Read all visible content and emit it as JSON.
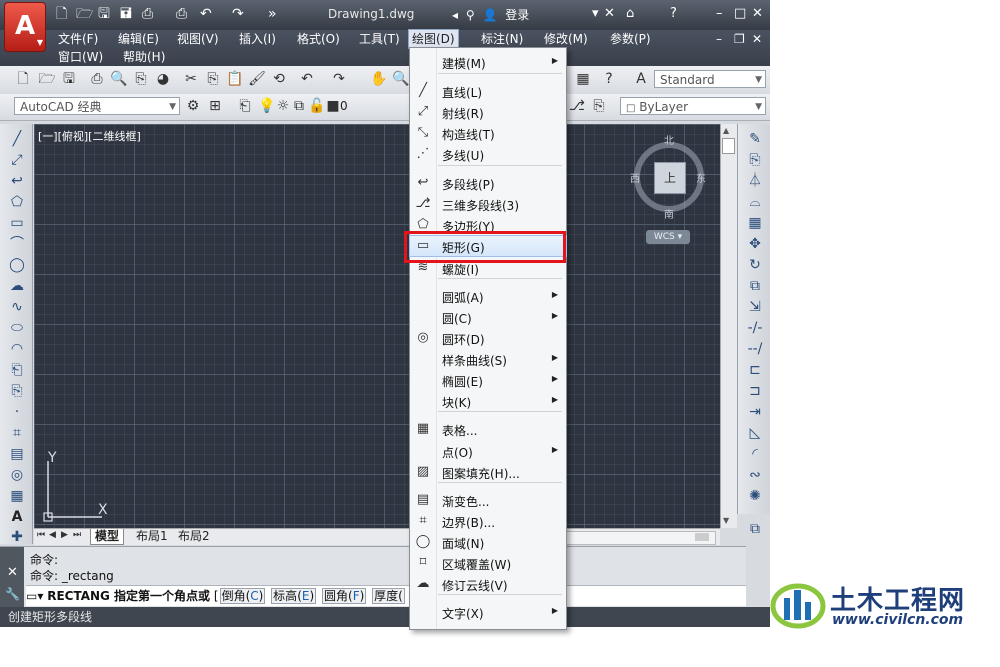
{
  "title_bar": {
    "logo_letter": "A",
    "doc_title": "Drawing1.dwg",
    "login_label": "登录",
    "help_label": "?"
  },
  "menubar": {
    "items": [
      "文件(F)",
      "编辑(E)",
      "视图(V)",
      "插入(I)",
      "格式(O)",
      "工具(T)",
      "绘图(D)",
      "标注(N)",
      "修改(M)",
      "参数(P)"
    ],
    "items_row2": [
      "窗口(W)",
      "帮助(H)"
    ],
    "active": "绘图(D)"
  },
  "toolbar1": {
    "text_style": "Standard"
  },
  "toolbar2": {
    "workspace": "AutoCAD 经典",
    "layer_value": "0",
    "linetype": "ByLayer"
  },
  "canvas": {
    "viewport_label": "[一][俯视][二维线框]",
    "viewcube": {
      "north": "北",
      "south": "南",
      "east": "东",
      "west": "西",
      "face": "上",
      "wcs": "WCS"
    },
    "ucs": {
      "x": "X",
      "y": "Y"
    }
  },
  "layout_tabs": [
    "模型",
    "布局1",
    "布局2"
  ],
  "command": {
    "history": [
      "命令:",
      "命令: _rectang"
    ],
    "prompt": "RECTANG 指定第一个角点或",
    "options": [
      {
        "label": "倒角",
        "key": "C"
      },
      {
        "label": "标高",
        "key": "E"
      },
      {
        "label": "圆角",
        "key": "F"
      },
      {
        "label": "厚度",
        "key": ""
      }
    ]
  },
  "status": {
    "text": "创建矩形多段线"
  },
  "draw_menu": {
    "items": [
      {
        "label": "建模(M)",
        "icon": "",
        "submenu": true
      },
      {
        "label": "直线(L)",
        "icon": "╱",
        "submenu": false
      },
      {
        "label": "射线(R)",
        "icon": "⤢",
        "submenu": false
      },
      {
        "label": "构造线(T)",
        "icon": "⤡",
        "submenu": false
      },
      {
        "label": "多线(U)",
        "icon": "⋰",
        "submenu": false
      },
      {
        "label": "多段线(P)",
        "icon": "↩",
        "submenu": false
      },
      {
        "label": "三维多段线(3)",
        "icon": "⎇",
        "submenu": false
      },
      {
        "label": "多边形(Y)",
        "icon": "⬠",
        "submenu": false
      },
      {
        "label": "矩形(G)",
        "icon": "▭",
        "submenu": false
      },
      {
        "label": "螺旋(I)",
        "icon": "≋",
        "submenu": false
      },
      {
        "label": "圆弧(A)",
        "icon": "",
        "submenu": true
      },
      {
        "label": "圆(C)",
        "icon": "",
        "submenu": true
      },
      {
        "label": "圆环(D)",
        "icon": "◎",
        "submenu": false
      },
      {
        "label": "样条曲线(S)",
        "icon": "",
        "submenu": true
      },
      {
        "label": "椭圆(E)",
        "icon": "",
        "submenu": true
      },
      {
        "label": "块(K)",
        "icon": "",
        "submenu": true
      },
      {
        "label": "表格...",
        "icon": "▦",
        "submenu": false
      },
      {
        "label": "点(O)",
        "icon": "",
        "submenu": true
      },
      {
        "label": "图案填充(H)...",
        "icon": "▨",
        "submenu": false
      },
      {
        "label": "渐变色...",
        "icon": "▤",
        "submenu": false
      },
      {
        "label": "边界(B)...",
        "icon": "⌗",
        "submenu": false
      },
      {
        "label": "面域(N)",
        "icon": "◯",
        "submenu": false
      },
      {
        "label": "区域覆盖(W)",
        "icon": "⌑",
        "submenu": false
      },
      {
        "label": "修订云线(V)",
        "icon": "☁",
        "submenu": false
      },
      {
        "label": "文字(X)",
        "icon": "",
        "submenu": true
      }
    ],
    "highlighted": "矩形(G)"
  },
  "watermark": {
    "name": "土木工程网",
    "url": "www.civilcn.com"
  },
  "colors": {
    "accent_red": "#e3141b",
    "canvas_bg": "#2f3540",
    "brand_blue": "#1f3f7a"
  }
}
